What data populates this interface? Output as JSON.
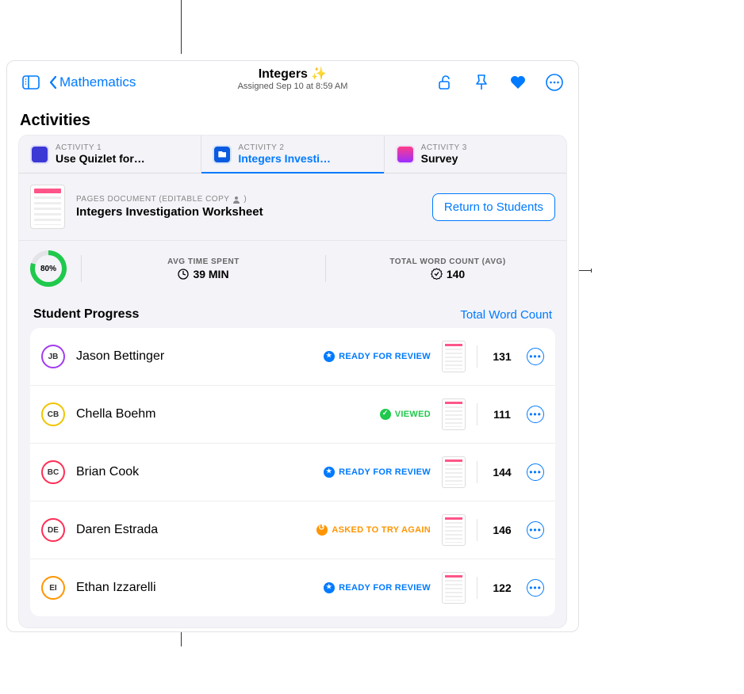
{
  "nav": {
    "back_label": "Mathematics",
    "title": "Integers ✨",
    "subtitle": "Assigned Sep 10 at 8:59 AM"
  },
  "section_title": "Activities",
  "tabs": [
    {
      "label": "ACTIVITY 1",
      "name": "Use Quizlet for…"
    },
    {
      "label": "ACTIVITY 2",
      "name": "Integers Investi…"
    },
    {
      "label": "ACTIVITY 3",
      "name": "Survey"
    }
  ],
  "document": {
    "label": "PAGES DOCUMENT (EDITABLE COPY",
    "label_suffix": ")",
    "title": "Integers Investigation Worksheet",
    "button": "Return to Students"
  },
  "stats": {
    "completion_pct": "80%",
    "time_label": "AVG TIME SPENT",
    "time_value": "39 MIN",
    "words_label": "TOTAL WORD COUNT (AVG)",
    "words_value": "140"
  },
  "progress_title": "Student Progress",
  "progress_link": "Total Word Count",
  "statuses": {
    "ready": "READY FOR REVIEW",
    "viewed": "VIEWED",
    "retry": "ASKED TO TRY AGAIN"
  },
  "students": [
    {
      "initials": "JB",
      "color": "#a33cf0",
      "name": "Jason Bettinger",
      "status": "ready",
      "count": "131"
    },
    {
      "initials": "CB",
      "color": "#f0c400",
      "name": "Chella Boehm",
      "status": "viewed",
      "count": "111"
    },
    {
      "initials": "BC",
      "color": "#ff2d55",
      "name": "Brian Cook",
      "status": "ready",
      "count": "144"
    },
    {
      "initials": "DE",
      "color": "#ff2d55",
      "name": "Daren Estrada",
      "status": "retry",
      "count": "146"
    },
    {
      "initials": "EI",
      "color": "#ff9500",
      "name": "Ethan Izzarelli",
      "status": "ready",
      "count": "122"
    }
  ]
}
